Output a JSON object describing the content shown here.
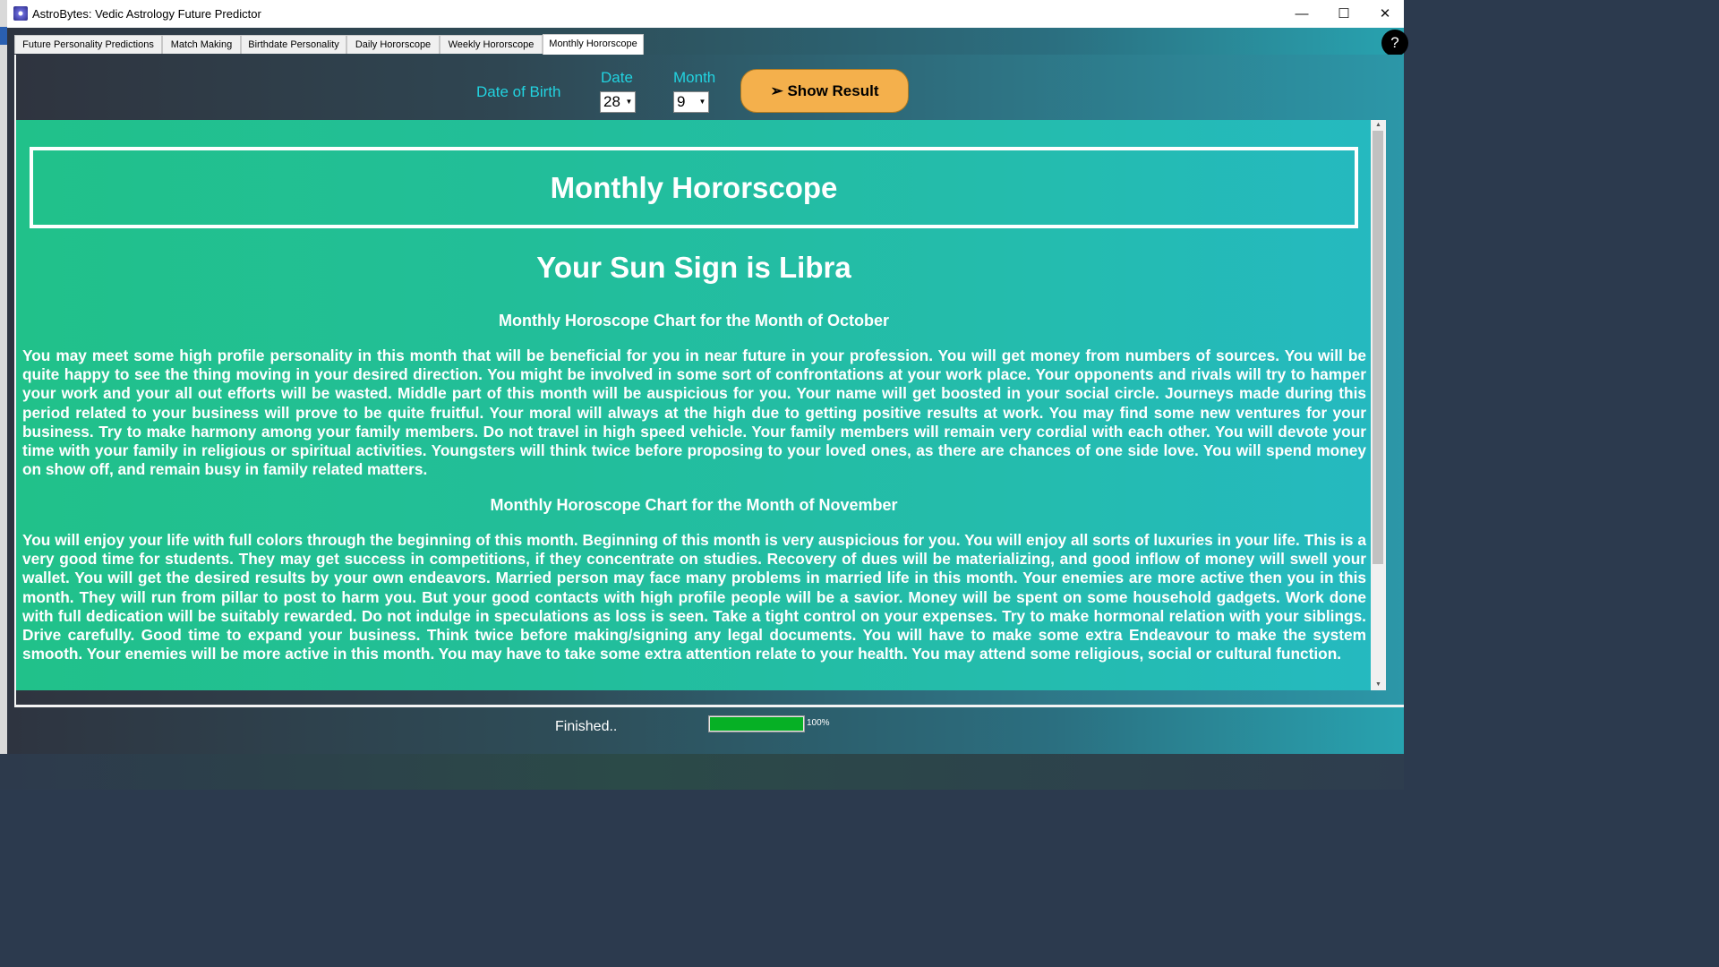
{
  "window": {
    "title": "AstroBytes: Vedic Astrology Future Predictor",
    "minimize": "—",
    "maximize": "☐",
    "close": "✕"
  },
  "tabs": [
    {
      "label": "Future  Personality Predictions"
    },
    {
      "label": "Match Making"
    },
    {
      "label": "Birthdate Personality"
    },
    {
      "label": "Daily Hororscope"
    },
    {
      "label": "Weekly Hororscope"
    },
    {
      "label": "Monthly Hororscope",
      "active": true
    }
  ],
  "help": "?",
  "form": {
    "dob_label": "Date of Birth",
    "date_label": "Date",
    "date_value": "28",
    "month_label": "Month",
    "month_value": "9",
    "show_result": "➢ Show Result"
  },
  "result": {
    "heading": "Monthly Hororscope",
    "sun_sign": "Your Sun Sign is Libra",
    "months": [
      {
        "title": "Monthly Horoscope Chart for the Month of October",
        "text": "You may meet some high profile personality in this month that will be beneficial for you in near future in your profession. You will get money from numbers of sources. You will be quite happy to see the thing moving in your desired direction. You might be involved in some sort of confrontations at your work place. Your opponents and rivals will try to hamper your work and your all out efforts will be wasted. Middle part of this month will be auspicious for you. Your name will get boosted in your social circle. Journeys made during this period related to your business will prove to be quite fruitful. Your moral will always at the high due to getting positive results at work. You may find some new ventures for your business. Try to make harmony among your family members. Do not travel in high speed vehicle. Your family members will remain very cordial with each other. You will devote your time with your family in religious or spiritual activities. Youngsters will think twice before proposing to your loved ones, as there are chances of one side love. You will spend money on show off, and remain busy in family related matters."
      },
      {
        "title": "Monthly Horoscope Chart for the Month of November",
        "text": "You will enjoy your life with full colors through the beginning of this month. Beginning of this month is very auspicious for you. You will enjoy all sorts of luxuries in your life. This is a very good time for students. They may get success in competitions, if they concentrate on studies. Recovery of dues will be materializing, and good inflow of money will swell your wallet. You will get the desired results by your own endeavors. Married person may face many problems in married life in this month. Your enemies are more active then you in this month. They will run from pillar to post to harm you. But your good contacts with high profile people will be a savior. Money will be spent on some household gadgets. Work done with full dedication will be suitably rewarded. Do not indulge in speculations as loss is seen. Take a tight control on your expenses. Try to make hormonal relation with your siblings. Drive carefully. Good time to expand your business. Think twice before making/signing any legal documents. You will have to make some extra Endeavour to make the system smooth. Your enemies will be more active in this month. You may have to take some extra attention relate to your health. You may attend some religious, social or cultural function."
      }
    ]
  },
  "status": {
    "text": "Finished..",
    "progress_percent": 100,
    "progress_label": "100%"
  },
  "colors": {
    "accent_label": "#22d3e0",
    "button": "#f4b04c",
    "content_bg": "#22be9a",
    "progress": "#06b025"
  }
}
